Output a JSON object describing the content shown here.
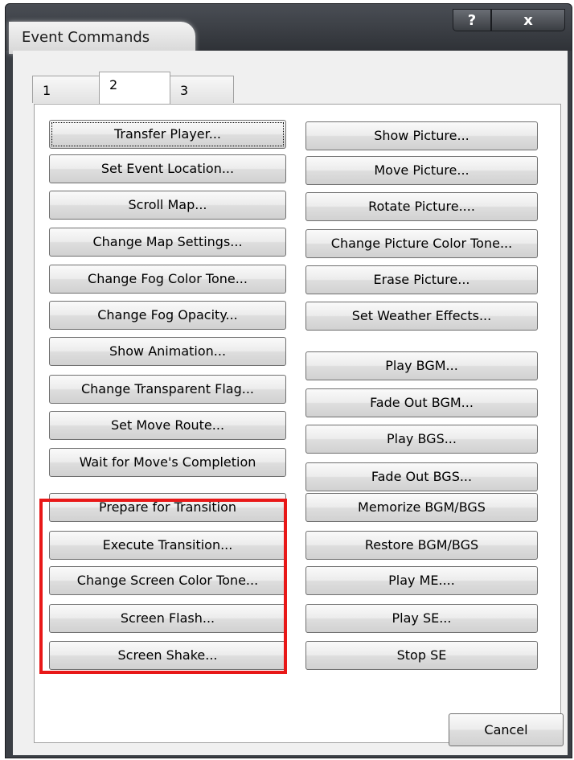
{
  "window": {
    "title": "Event Commands",
    "help_glyph": "?",
    "close_glyph": "x"
  },
  "tabs": [
    {
      "label": "1"
    },
    {
      "label": "2"
    },
    {
      "label": "3"
    }
  ],
  "active_tab": "2",
  "left_commands": [
    {
      "label": "Transfer Player..."
    },
    {
      "label": "Set Event Location..."
    },
    {
      "label": "Scroll Map..."
    },
    {
      "label": "Change Map Settings..."
    },
    {
      "label": "Change Fog Color Tone..."
    },
    {
      "label": "Change Fog Opacity..."
    },
    {
      "label": "Show Animation..."
    },
    {
      "label": "Change Transparent Flag..."
    },
    {
      "label": "Set Move Route..."
    },
    {
      "label": "Wait for Move's Completion"
    },
    {
      "label": "Prepare for Transition"
    },
    {
      "label": "Execute Transition..."
    },
    {
      "label": "Change Screen Color Tone..."
    },
    {
      "label": "Screen Flash..."
    },
    {
      "label": "Screen Shake..."
    }
  ],
  "right_commands": [
    {
      "label": "Show Picture..."
    },
    {
      "label": "Move Picture..."
    },
    {
      "label": "Rotate Picture...."
    },
    {
      "label": "Change Picture Color Tone..."
    },
    {
      "label": "Erase Picture..."
    },
    {
      "label": "Set Weather Effects..."
    },
    {
      "label": "Play BGM..."
    },
    {
      "label": "Fade Out BGM..."
    },
    {
      "label": "Play BGS..."
    },
    {
      "label": "Fade Out BGS..."
    },
    {
      "label": "Memorize BGM/BGS"
    },
    {
      "label": "Restore BGM/BGS"
    },
    {
      "label": "Play ME...."
    },
    {
      "label": "Play SE..."
    },
    {
      "label": "Stop SE"
    }
  ],
  "footer": {
    "cancel_label": "Cancel"
  },
  "colors": {
    "highlight": "#e81818",
    "frame": "#3b3f45"
  }
}
